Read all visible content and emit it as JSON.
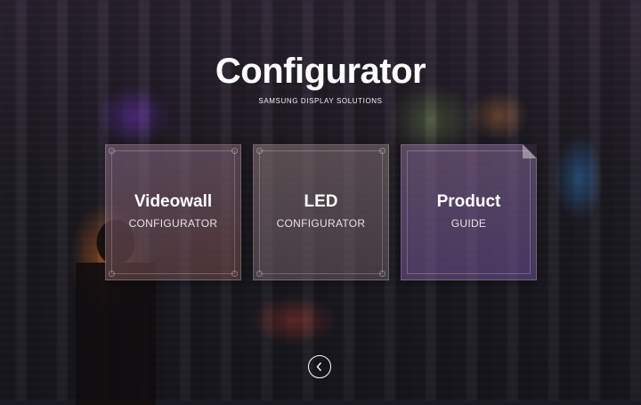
{
  "header": {
    "title": "Configurator",
    "subtitle": "SAMSUNG DISPLAY SOLUTIONS"
  },
  "tiles": [
    {
      "title": "Videowall",
      "subtitle": "CONFIGURATOR",
      "icon": "corner-dots"
    },
    {
      "title": "LED",
      "subtitle": "CONFIGURATOR",
      "icon": "corner-dots"
    },
    {
      "title": "Product",
      "subtitle": "GUIDE",
      "icon": "folded-page-corner"
    }
  ],
  "navigation": {
    "back_icon": "chevron-left-icon"
  }
}
